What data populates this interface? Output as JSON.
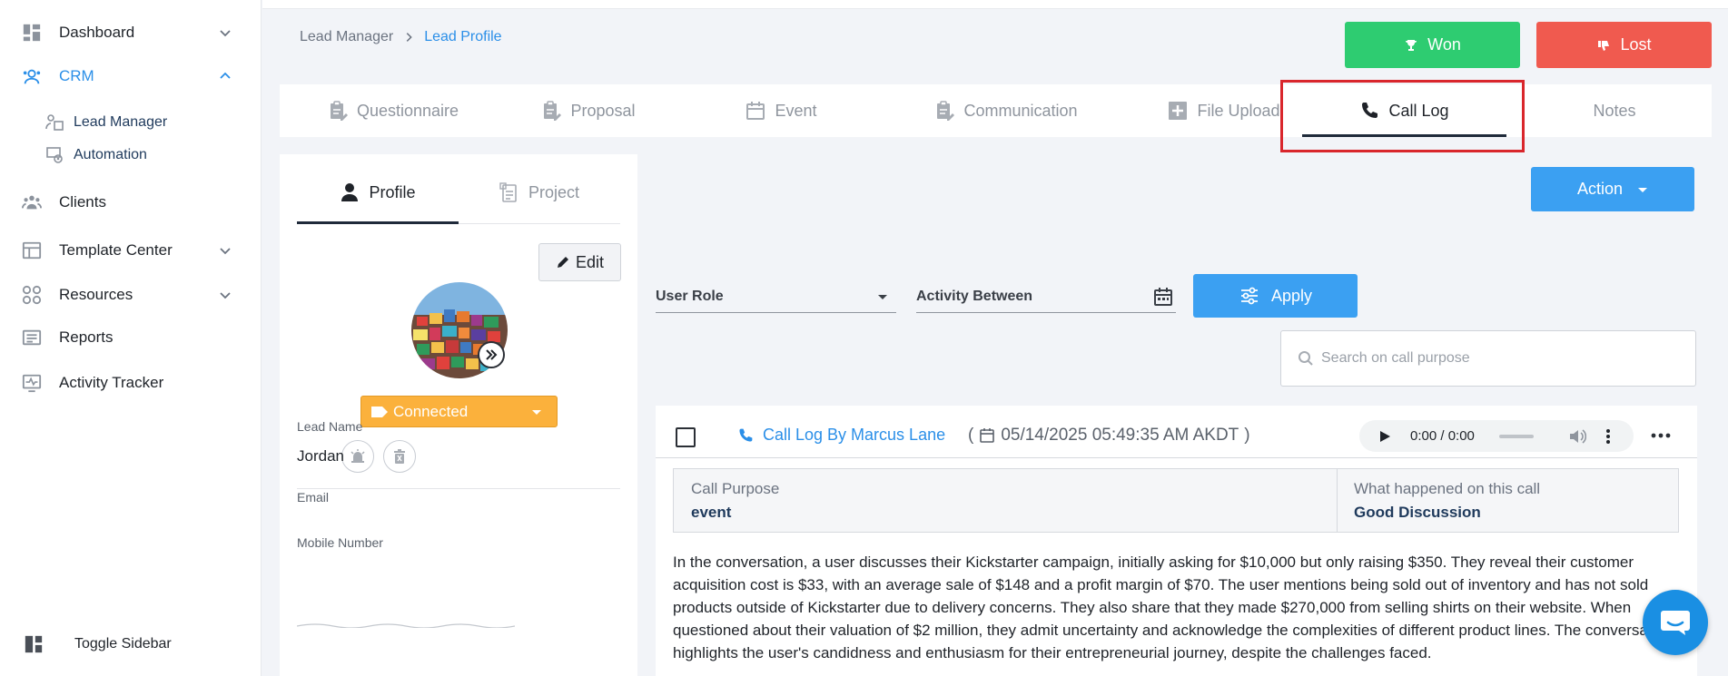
{
  "sidebar": {
    "items": [
      {
        "label": "Dashboard"
      },
      {
        "label": "CRM"
      },
      {
        "label": "Lead Manager"
      },
      {
        "label": "Automation"
      },
      {
        "label": "Clients"
      },
      {
        "label": "Template Center"
      },
      {
        "label": "Resources"
      },
      {
        "label": "Reports"
      },
      {
        "label": "Activity Tracker"
      }
    ],
    "toggle_label": "Toggle Sidebar"
  },
  "breadcrumb": {
    "items": [
      "Lead Manager",
      "Lead Profile"
    ]
  },
  "header": {
    "won_label": "Won",
    "lost_label": "Lost"
  },
  "tabs": [
    {
      "label": "Questionnaire"
    },
    {
      "label": "Proposal"
    },
    {
      "label": "Event"
    },
    {
      "label": "Communication"
    },
    {
      "label": "File Upload"
    },
    {
      "label": "Call Log"
    },
    {
      "label": "Notes"
    }
  ],
  "profile": {
    "tabs": [
      {
        "label": "Profile"
      },
      {
        "label": "Project"
      }
    ],
    "edit_label": "Edit",
    "status": "Connected",
    "fields": [
      {
        "label": "Lead Name",
        "value": "Jordan"
      },
      {
        "label": "Email",
        "value": ""
      },
      {
        "label": "Mobile Number",
        "value": ""
      }
    ]
  },
  "calllog": {
    "action_label": "Action",
    "filters": {
      "user_role": "User Role",
      "activity_between": "Activity Between",
      "apply_label": "Apply"
    },
    "search": {
      "placeholder": "Search on call purpose",
      "value": ""
    },
    "entry": {
      "title": "Call Log By Marcus Lane",
      "open_paren": "(",
      "close_paren": ")",
      "datetime": "05/14/2025 05:49:35 AM AKDT",
      "audio_time": "0:00 / 0:00",
      "purpose_label": "Call Purpose",
      "purpose_value": "event",
      "outcome_label": "What happened on this call",
      "outcome_value": "Good Discussion",
      "summary": "In the conversation, a user discusses their Kickstarter campaign, initially asking for $10,000 but only raising $350. They reveal their customer acquisition cost is $33, with an average sale of $148 and a profit margin of $70. The user mentions being sold out of inventory and has not sold products outside of Kickstarter due to delivery concerns. They also share that they made $270,000 from selling shirts on their website. When questioned about their valuation of $2 million, they admit uncertainty and acknowledge the complexities of different product lines. The conversation highlights the user's candidness and enthusiasm for their entrepreneurial journey, despite the challenges faced."
    }
  },
  "colors": {
    "accent": "#2b8fe8",
    "won": "#2ecc71",
    "lost": "#f05a4f",
    "status": "#fbb13c",
    "highlight": "#d9262c"
  },
  "icons": {
    "sidebar": [
      "dashboard-icon",
      "crm-icon",
      "lead-manager-icon",
      "automation-icon",
      "clients-icon",
      "template-icon",
      "resources-icon",
      "reports-icon",
      "activity-tracker-icon",
      "toggle-sidebar-icon"
    ],
    "tabs": [
      "questionnaire-icon",
      "proposal-icon",
      "event-icon",
      "communication-icon",
      "file-upload-icon",
      "phone-icon"
    ]
  }
}
